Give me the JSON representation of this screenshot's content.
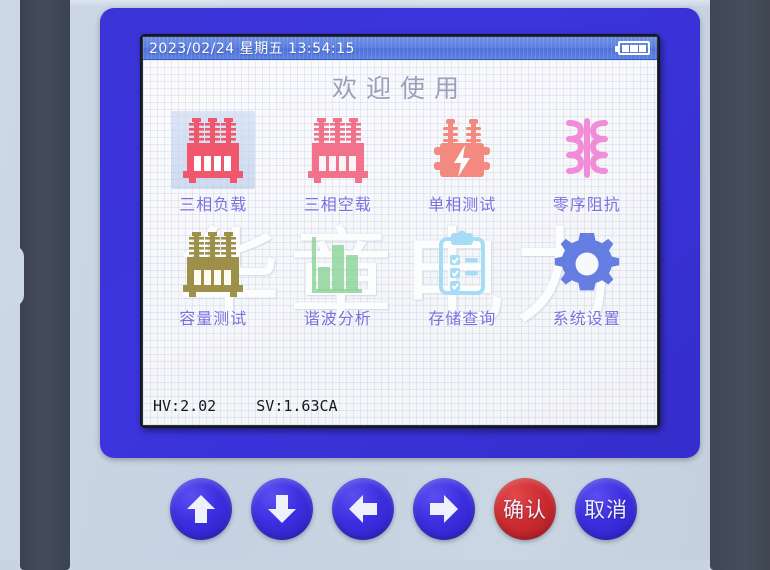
{
  "device": {
    "brand_watermark": "华章电力"
  },
  "screen": {
    "titlebar": {
      "date": "2023/02/24",
      "weekday": "星期五",
      "time": "13:54:15",
      "full_text": "2023/02/24 星期五 13:54:15",
      "battery_icon": "battery-icon",
      "battery_bars": 3,
      "bg_color": "#5b7fe0"
    },
    "welcome_title": "欢迎使用",
    "menu": [
      {
        "label": "三相负载",
        "icon": "three-phase-transformer-icon",
        "color": "#f05a6e",
        "selected": true
      },
      {
        "label": "三相空载",
        "icon": "three-phase-transformer-icon",
        "color": "#f1728a",
        "selected": false
      },
      {
        "label": "单相测试",
        "icon": "single-phase-bolt-icon",
        "color": "#f3897f",
        "selected": false
      },
      {
        "label": "零序阻抗",
        "icon": "zero-sequence-coil-icon",
        "color": "#f08cd8",
        "selected": false
      },
      {
        "label": "容量测试",
        "icon": "capacity-transformer-icon",
        "color": "#97883a",
        "selected": false
      },
      {
        "label": "谐波分析",
        "icon": "harmonic-bar-chart-icon",
        "color": "#8ed69a",
        "selected": false
      },
      {
        "label": "存储查询",
        "icon": "storage-clipboard-icon",
        "color": "#a6dcf5",
        "selected": false
      },
      {
        "label": "系统设置",
        "icon": "system-gear-icon",
        "color": "#5a74e0",
        "selected": false
      }
    ],
    "status": {
      "hv_label": "HV:2.02",
      "sv_label": "SV:1.63CA"
    },
    "label_color": "#7b6fe0"
  },
  "keypad": {
    "keys": [
      {
        "name": "up",
        "icon": "arrow-up-icon",
        "label": "",
        "color": "#3d2fe0"
      },
      {
        "name": "down",
        "icon": "arrow-down-icon",
        "label": "",
        "color": "#3d2fe0"
      },
      {
        "name": "left",
        "icon": "arrow-left-icon",
        "label": "",
        "color": "#3d2fe0"
      },
      {
        "name": "right",
        "icon": "arrow-right-icon",
        "label": "",
        "color": "#3d2fe0"
      },
      {
        "name": "confirm",
        "icon": "",
        "label": "确认",
        "color": "#cc2b30"
      },
      {
        "name": "cancel",
        "icon": "",
        "label": "取消",
        "color": "#3d2fe0"
      }
    ]
  }
}
